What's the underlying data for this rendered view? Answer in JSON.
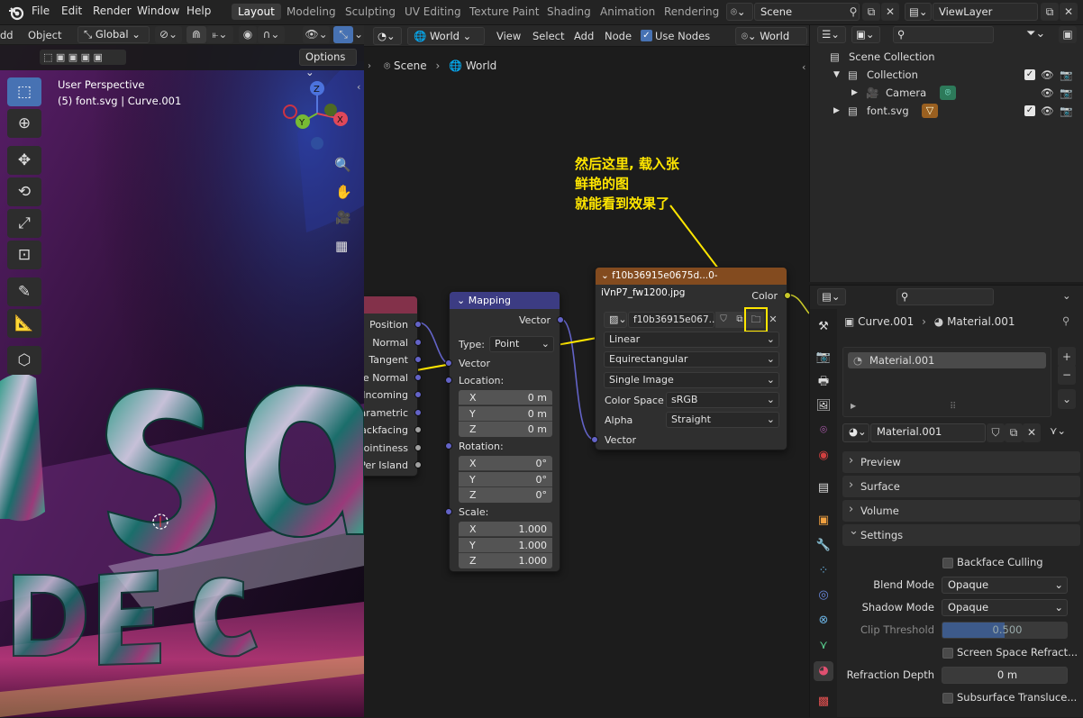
{
  "menu": [
    "File",
    "Edit",
    "Render",
    "Window",
    "Help"
  ],
  "workspaces": [
    "Layout",
    "Modeling",
    "Sculpting",
    "UV Editing",
    "Texture Paint",
    "Shading",
    "Animation",
    "Rendering"
  ],
  "scene": {
    "label": "Scene",
    "viewlayer": "ViewLayer"
  },
  "viewport": {
    "menu_add": "dd",
    "menu_object": "Object",
    "orientation": "Global",
    "options": "Options",
    "perspective": "User Perspective",
    "object_info": "(5) font.svg | Curve.001",
    "gizmo": {
      "x": "X",
      "y": "Y",
      "z": "Z"
    }
  },
  "node_editor": {
    "world_dropdown": "World",
    "menu": [
      "View",
      "Select",
      "Add",
      "Node"
    ],
    "use_nodes": "Use Nodes",
    "world_right": "World",
    "breadcrumb": [
      "Scene",
      "World"
    ],
    "annotation": [
      "然后这里, 载入张",
      "鲜艳的图",
      "就能看到效果了"
    ],
    "texcoord_outputs": [
      "Position",
      "Normal",
      "Tangent",
      "ue Normal",
      "Incoming",
      "Parametric",
      "Backfacing",
      "Pointiness",
      "Per Island"
    ],
    "mapping": {
      "title": "Mapping",
      "output": "Vector",
      "type_label": "Type:",
      "type_value": "Point",
      "vector": "Vector",
      "location": "Location:",
      "rotation": "Rotation:",
      "scale": "Scale:",
      "loc": [
        {
          "a": "X",
          "v": "0 m"
        },
        {
          "a": "Y",
          "v": "0 m"
        },
        {
          "a": "Z",
          "v": "0 m"
        }
      ],
      "rot": [
        {
          "a": "X",
          "v": "0°"
        },
        {
          "a": "Y",
          "v": "0°"
        },
        {
          "a": "Z",
          "v": "0°"
        }
      ],
      "scl": [
        {
          "a": "X",
          "v": "1.000"
        },
        {
          "a": "Y",
          "v": "1.000"
        },
        {
          "a": "Z",
          "v": "1.000"
        }
      ]
    },
    "image": {
      "title": "f10b36915e0675d...0-iVnP7_fw1200.jpg",
      "output": "Color",
      "image_name": "f10b36915e067...",
      "interp": "Linear",
      "projection": "Equirectangular",
      "source": "Single Image",
      "colorspace_label": "Color Space",
      "colorspace": "sRGB",
      "alpha_label": "Alpha",
      "alpha": "Straight",
      "input": "Vector"
    }
  },
  "outliner": {
    "items": [
      {
        "label": "Scene Collection"
      },
      {
        "label": "Collection"
      },
      {
        "label": "Camera"
      },
      {
        "label": "font.svg"
      }
    ]
  },
  "properties": {
    "object": "Curve.001",
    "material": "Material.001",
    "slot": "Material.001",
    "datablock": "Material.001",
    "panels": [
      "Preview",
      "Surface",
      "Volume",
      "Settings"
    ],
    "settings": {
      "backface": "Backface Culling",
      "blend_label": "Blend Mode",
      "blend": "Opaque",
      "shadow_label": "Shadow Mode",
      "shadow": "Opaque",
      "clip_label": "Clip Threshold",
      "clip": "0.500",
      "ssr": "Screen Space Refract...",
      "refr_label": "Refraction Depth",
      "refr": "0 m",
      "sss": "Subsurface Translucе..."
    }
  },
  "colors": {
    "accent": "#4772b3",
    "annotation": "#ffe600",
    "mapping_header": "#3c3c83",
    "image_header": "#834b1f",
    "texcoord_header": "#83314a",
    "vector_socket": "#6363c7",
    "color_socket": "#c7c729",
    "float_socket": "#a1a1a1"
  }
}
